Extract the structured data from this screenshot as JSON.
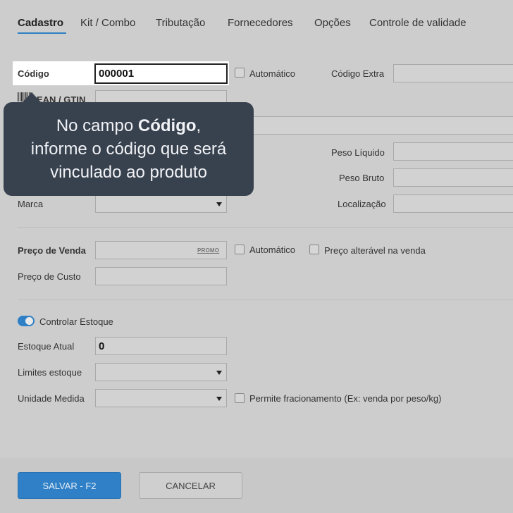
{
  "tabs": [
    {
      "label": "Cadastro",
      "active": true
    },
    {
      "label": "Kit / Combo"
    },
    {
      "label": "Tributação"
    },
    {
      "label": "Fornecedores"
    },
    {
      "label": "Opções"
    },
    {
      "label": "Controle de validade"
    }
  ],
  "form": {
    "codigo_label": "Código",
    "codigo_value": "000001",
    "automatico_label": "Automático",
    "codigo_extra_label": "Código Extra",
    "ean_label": "EAN / GTIN",
    "peso_liquido_label": "Peso Líquido",
    "peso_bruto_label": "Peso Bruto",
    "marca_label": "Marca",
    "localizacao_label": "Localização",
    "preco_venda_label": "Preço de Venda",
    "promo_label": "PROMO",
    "preco_automatico_label": "Automático",
    "preco_alteravel_label": "Preço alterável na venda",
    "preco_custo_label": "Preço de Custo",
    "controlar_estoque_label": "Controlar Estoque",
    "estoque_atual_label": "Estoque Atual",
    "estoque_atual_value": "0",
    "limites_estoque_label": "Limites estoque",
    "unidade_medida_label": "Unidade Medida",
    "permite_fracionamento_label": "Permite fracionamento (Ex: venda por peso/kg)"
  },
  "tooltip": {
    "prefix": "No campo ",
    "emphasis": "Código",
    "suffix": ",",
    "line2": "informe o código que será",
    "line3": "vinculado ao produto"
  },
  "footer": {
    "save_label": "SALVAR - F2",
    "cancel_label": "CANCELAR"
  },
  "colors": {
    "accent": "#2f80c7",
    "tooltip_bg": "#38414e"
  }
}
